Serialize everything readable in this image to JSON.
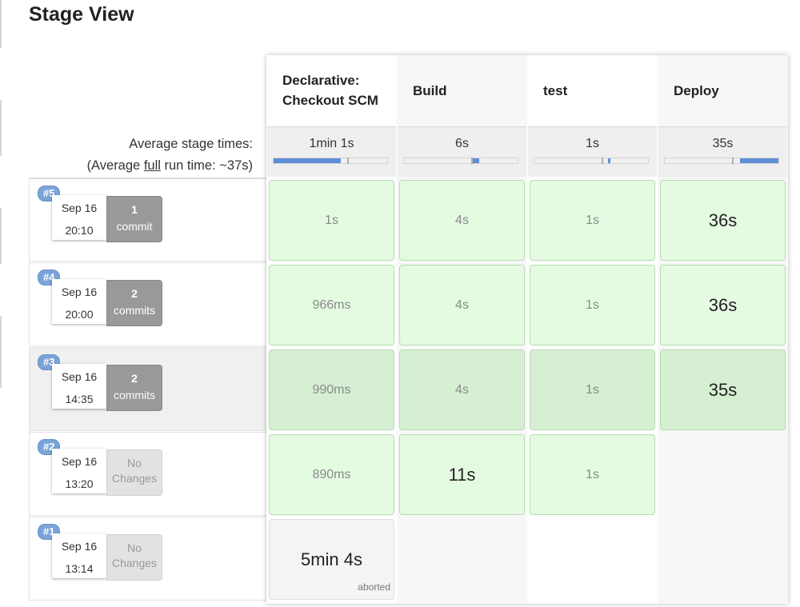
{
  "page": {
    "title": "Stage View"
  },
  "summary": {
    "avg_stage_label": "Average stage times:",
    "avg_full_prefix": "(Average ",
    "avg_full_link": "full",
    "avg_full_suffix": " run time: ~37s)"
  },
  "stages": [
    {
      "name_line1": "Declarative:",
      "name_line2": "Checkout SCM",
      "avg_time": "1min 1s",
      "avg_fraction": 0.59
    },
    {
      "name_line1": "Build",
      "name_line2": "",
      "avg_time": "6s",
      "avg_fraction": 0.06
    },
    {
      "name_line1": "test",
      "name_line2": "",
      "avg_time": "1s",
      "avg_fraction": 0.01
    },
    {
      "name_line1": "Deploy",
      "name_line2": "",
      "avg_time": "35s",
      "avg_fraction": 0.34
    }
  ],
  "runs": [
    {
      "id": "#5",
      "date": "Sep 16",
      "time": "20:10",
      "changes_count": "1",
      "changes_word": "commit",
      "has_changes": true,
      "cells": [
        {
          "duration": "1s"
        },
        {
          "duration": "4s"
        },
        {
          "duration": "1s"
        },
        {
          "duration": "36s"
        }
      ]
    },
    {
      "id": "#4",
      "date": "Sep 16",
      "time": "20:00",
      "changes_count": "2",
      "changes_word": "commits",
      "has_changes": true,
      "cells": [
        {
          "duration": "966ms"
        },
        {
          "duration": "4s"
        },
        {
          "duration": "1s"
        },
        {
          "duration": "36s"
        }
      ]
    },
    {
      "id": "#3",
      "date": "Sep 16",
      "time": "14:35",
      "changes_count": "2",
      "changes_word": "commits",
      "has_changes": true,
      "cells": [
        {
          "duration": "990ms"
        },
        {
          "duration": "4s"
        },
        {
          "duration": "1s"
        },
        {
          "duration": "35s"
        }
      ]
    },
    {
      "id": "#2",
      "date": "Sep 16",
      "time": "13:20",
      "changes_count": "No",
      "changes_word": "Changes",
      "has_changes": false,
      "cells": [
        {
          "duration": "890ms"
        },
        {
          "duration": "11s"
        },
        {
          "duration": "1s"
        }
      ]
    },
    {
      "id": "#1",
      "date": "Sep 16",
      "time": "13:14",
      "changes_count": "No",
      "changes_word": "Changes",
      "has_changes": false,
      "cells": [
        {
          "duration": "5min 4s",
          "status": "aborted"
        }
      ]
    }
  ],
  "colors": {
    "success_cell": "#e4fbe1",
    "success_border": "#b6dbb1",
    "progress_fill": "#5f8fd6",
    "badge": "#7aa4d9"
  }
}
